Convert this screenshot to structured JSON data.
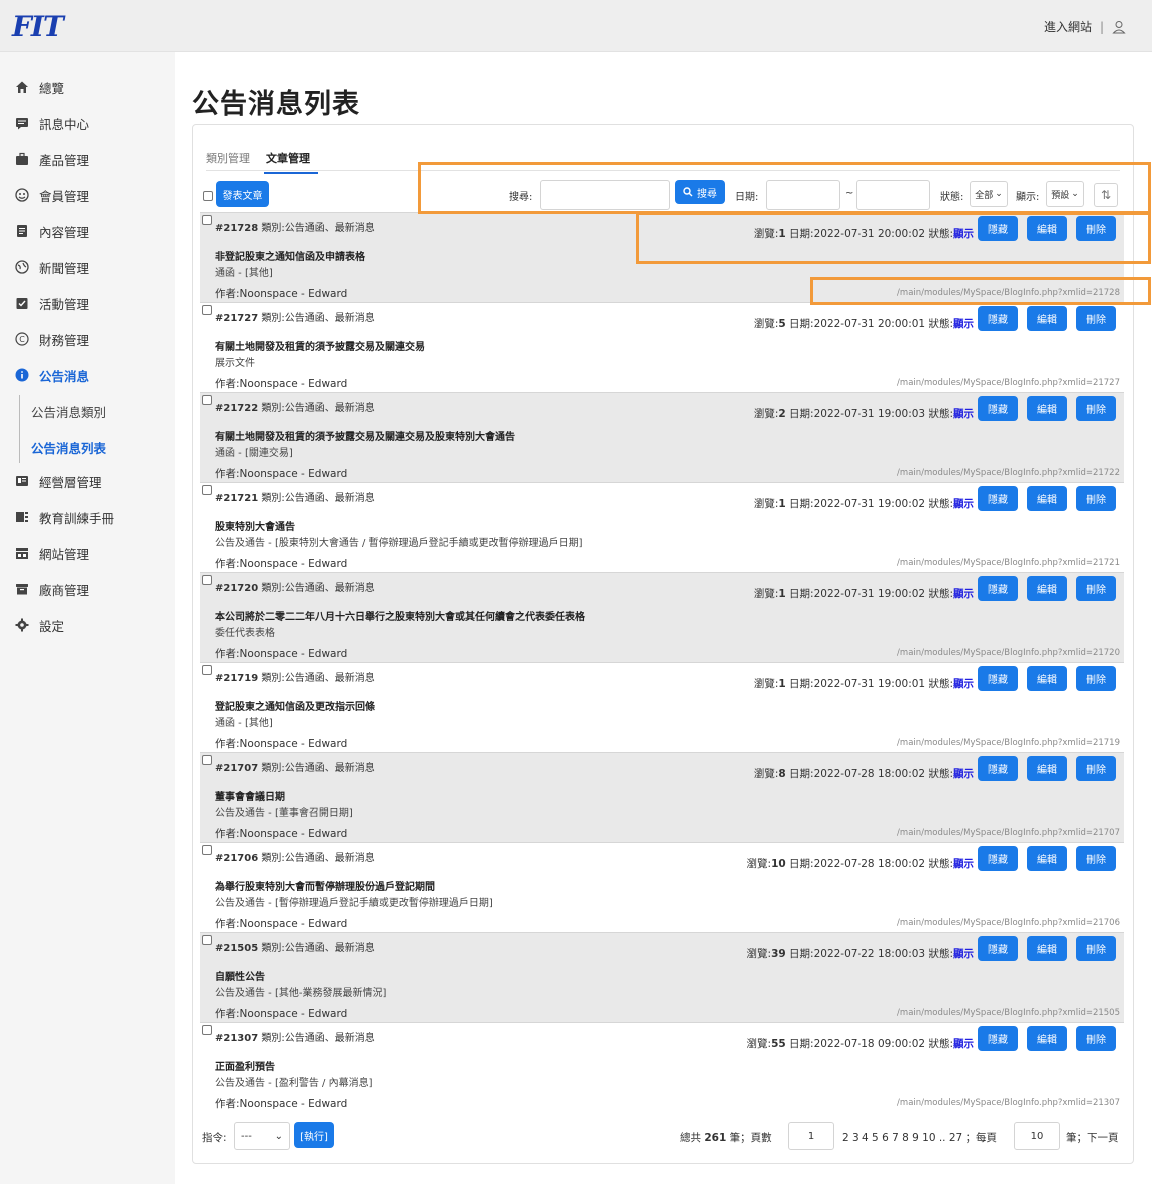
{
  "header": {
    "logo": "FIT",
    "enter_site": "進入網站",
    "separator": "|"
  },
  "sidebar": {
    "items": [
      {
        "label": "總覽",
        "icon": "home-icon"
      },
      {
        "label": "訊息中心",
        "icon": "message-icon"
      },
      {
        "label": "產品管理",
        "icon": "product-icon"
      },
      {
        "label": "會員管理",
        "icon": "member-icon"
      },
      {
        "label": "內容管理",
        "icon": "content-icon"
      },
      {
        "label": "新聞管理",
        "icon": "news-icon"
      },
      {
        "label": "活動管理",
        "icon": "event-icon"
      },
      {
        "label": "財務管理",
        "icon": "finance-icon"
      },
      {
        "label": "公告消息",
        "icon": "info-icon"
      },
      {
        "label": "經營層管理",
        "icon": "management-icon"
      },
      {
        "label": "教育訓練手冊",
        "icon": "manual-icon"
      },
      {
        "label": "網站管理",
        "icon": "site-icon"
      },
      {
        "label": "廠商管理",
        "icon": "vendor-icon"
      },
      {
        "label": "設定",
        "icon": "gear-icon"
      }
    ],
    "sub_items": [
      "公告消息類別",
      "公告消息列表"
    ]
  },
  "page": {
    "title": "公告消息列表"
  },
  "tabs": [
    "類別管理",
    "文章管理"
  ],
  "toolbar": {
    "post_button": "發表文章",
    "search_label": "搜尋:",
    "search_button": "搜尋",
    "date_label": "日期:",
    "date_sep": "~",
    "status_label": "狀態:",
    "status_value": "全部",
    "display_label": "顯示:",
    "display_value": "預設"
  },
  "articles": [
    {
      "id": "#21728",
      "category": "類別:公告通函、最新消息",
      "title": "非登記股東之通知信函及申請表格",
      "subtitle": "通函 - [其他]",
      "author": "作者:Noonspace - Edward",
      "views_label": "瀏覽:",
      "views": "1",
      "date": "日期:2022-07-31 20:00:02",
      "status_label": "狀態:",
      "status": "顯示",
      "url": "/main/modules/MySpace/BlogInfo.php?xmlid=21728"
    },
    {
      "id": "#21727",
      "category": "類別:公告通函、最新消息",
      "title": "有關土地開發及租賃的須予披露交易及關連交易",
      "subtitle": "展示文件",
      "author": "作者:Noonspace - Edward",
      "views_label": "瀏覽:",
      "views": "5",
      "date": "日期:2022-07-31 20:00:01",
      "status_label": "狀態:",
      "status": "顯示",
      "url": "/main/modules/MySpace/BlogInfo.php?xmlid=21727"
    },
    {
      "id": "#21722",
      "category": "類別:公告通函、最新消息",
      "title": "有關土地開發及租賃的須予披露交易及關連交易及股東特別大會通告",
      "subtitle": "通函 - [關連交易]",
      "author": "作者:Noonspace - Edward",
      "views_label": "瀏覽:",
      "views": "2",
      "date": "日期:2022-07-31 19:00:03",
      "status_label": "狀態:",
      "status": "顯示",
      "url": "/main/modules/MySpace/BlogInfo.php?xmlid=21722"
    },
    {
      "id": "#21721",
      "category": "類別:公告通函、最新消息",
      "title": "股東特別大會通告",
      "subtitle": "公告及通告 - [股東特別大會通告 / 暫停辦理過戶登記手續或更改暫停辦理過戶日期]",
      "author": "作者:Noonspace - Edward",
      "views_label": "瀏覽:",
      "views": "1",
      "date": "日期:2022-07-31 19:00:02",
      "status_label": "狀態:",
      "status": "顯示",
      "url": "/main/modules/MySpace/BlogInfo.php?xmlid=21721"
    },
    {
      "id": "#21720",
      "category": "類別:公告通函、最新消息",
      "title": "本公司將於二零二二年八月十六日舉行之股東特別大會或其任何續會之代表委任表格",
      "subtitle": "委任代表表格",
      "author": "作者:Noonspace - Edward",
      "views_label": "瀏覽:",
      "views": "1",
      "date": "日期:2022-07-31 19:00:02",
      "status_label": "狀態:",
      "status": "顯示",
      "url": "/main/modules/MySpace/BlogInfo.php?xmlid=21720"
    },
    {
      "id": "#21719",
      "category": "類別:公告通函、最新消息",
      "title": "登記股東之通知信函及更改指示回條",
      "subtitle": "通函 - [其他]",
      "author": "作者:Noonspace - Edward",
      "views_label": "瀏覽:",
      "views": "1",
      "date": "日期:2022-07-31 19:00:01",
      "status_label": "狀態:",
      "status": "顯示",
      "url": "/main/modules/MySpace/BlogInfo.php?xmlid=21719"
    },
    {
      "id": "#21707",
      "category": "類別:公告通函、最新消息",
      "title": "董事會會議日期",
      "subtitle": "公告及通告 - [董事會召開日期]",
      "author": "作者:Noonspace - Edward",
      "views_label": "瀏覽:",
      "views": "8",
      "date": "日期:2022-07-28 18:00:02",
      "status_label": "狀態:",
      "status": "顯示",
      "url": "/main/modules/MySpace/BlogInfo.php?xmlid=21707"
    },
    {
      "id": "#21706",
      "category": "類別:公告通函、最新消息",
      "title": "為舉行股東特別大會而暫停辦理股份過戶登記期間",
      "subtitle": "公告及通告 - [暫停辦理過戶登記手續或更改暫停辦理過戶日期]",
      "author": "作者:Noonspace - Edward",
      "views_label": "瀏覽:",
      "views": "10",
      "date": "日期:2022-07-28 18:00:02",
      "status_label": "狀態:",
      "status": "顯示",
      "url": "/main/modules/MySpace/BlogInfo.php?xmlid=21706"
    },
    {
      "id": "#21505",
      "category": "類別:公告通函、最新消息",
      "title": "自願性公告",
      "subtitle": "公告及通告 - [其他-業務發展最新情況]",
      "author": "作者:Noonspace - Edward",
      "views_label": "瀏覽:",
      "views": "39",
      "date": "日期:2022-07-22 18:00:03",
      "status_label": "狀態:",
      "status": "顯示",
      "url": "/main/modules/MySpace/BlogInfo.php?xmlid=21505"
    },
    {
      "id": "#21307",
      "category": "類別:公告通函、最新消息",
      "title": "正面盈利預告",
      "subtitle": "公告及通告 - [盈利警告 / 內幕消息]",
      "author": "作者:Noonspace - Edward",
      "views_label": "瀏覽:",
      "views": "55",
      "date": "日期:2022-07-18 09:00:02",
      "status_label": "狀態:",
      "status": "顯示",
      "url": "/main/modules/MySpace/BlogInfo.php?xmlid=21307"
    }
  ],
  "row_buttons": {
    "hide": "隱藏",
    "edit": "編輯",
    "delete": "刪除"
  },
  "footer": {
    "command_label": "指令:",
    "command_value": "---",
    "execute_button": "[執行]",
    "total_prefix": "總共",
    "total": "261",
    "total_suffix": "筆；頁數",
    "page_value": "1",
    "pages": "2 3 4 5 6 7 8 9 10 .. 27",
    "per_page_label": "；每頁",
    "per_page_value": "10",
    "next": "筆；下一頁"
  },
  "colors": {
    "accent": "#1a7ae8",
    "highlight": "#f29a3a",
    "status_blue": "#2020e0",
    "active_nav": "#1a66d6"
  }
}
